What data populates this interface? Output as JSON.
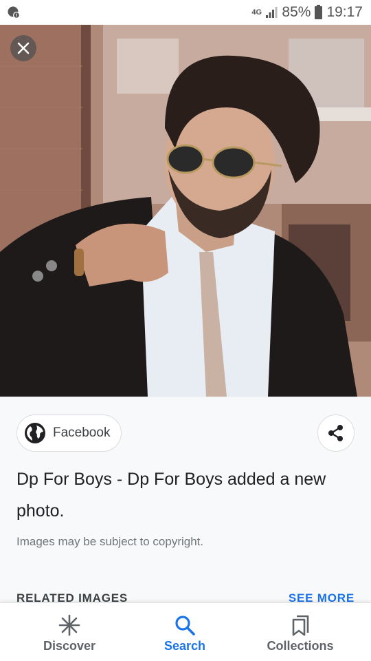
{
  "status_bar": {
    "network": "4G",
    "battery": "85%",
    "time": "19:17"
  },
  "photo": {
    "close_icon": "close-icon"
  },
  "source": {
    "label": "Facebook",
    "icon": "globe-icon"
  },
  "result": {
    "title": "Dp For Boys - Dp For Boys added a new photo.",
    "copyright": "Images may be subject to copyright."
  },
  "related": {
    "heading": "RELATED IMAGES",
    "see_more": "SEE MORE"
  },
  "nav": {
    "items": [
      {
        "label": "Discover",
        "icon": "discover-icon"
      },
      {
        "label": "Search",
        "icon": "search-icon"
      },
      {
        "label": "Collections",
        "icon": "bookmark-icon"
      }
    ],
    "active_color": "#1a73e8"
  }
}
